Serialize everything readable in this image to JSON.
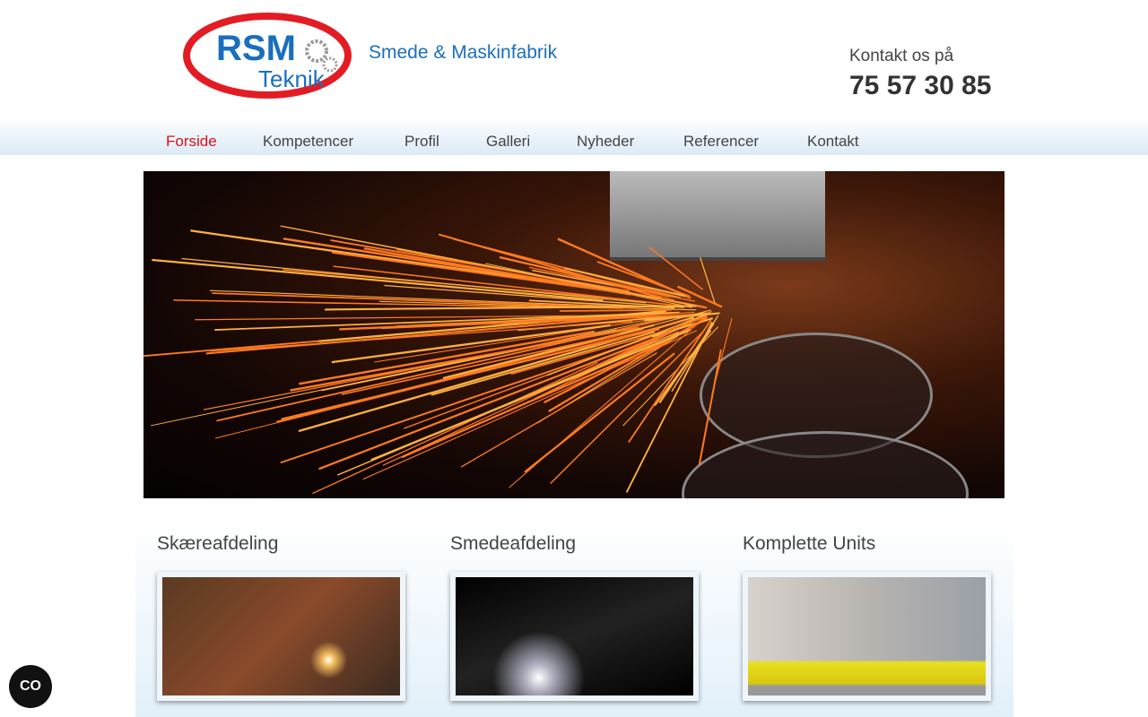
{
  "logo": {
    "text_top": "RSM",
    "text_bottom": "Teknik"
  },
  "header": {
    "tagline": "Smede & Maskinfabrik",
    "contact_label": "Kontakt os på",
    "contact_phone": "75 57 30 85"
  },
  "nav": {
    "items": [
      {
        "label": "Forside",
        "active": true
      },
      {
        "label": "Kompetencer"
      },
      {
        "label": "Profil"
      },
      {
        "label": "Galleri"
      },
      {
        "label": "Nyheder"
      },
      {
        "label": "Referencer"
      },
      {
        "label": "Kontakt"
      }
    ]
  },
  "sections": [
    {
      "title": "Skæreafdeling"
    },
    {
      "title": "Smedeafdeling"
    },
    {
      "title": "Komplette Units"
    }
  ],
  "accessibility": {
    "icon": "accessibility-toggle-icon",
    "label": "CO"
  },
  "colors": {
    "brand_blue": "#1a6fbd",
    "brand_red": "#d8121a"
  }
}
